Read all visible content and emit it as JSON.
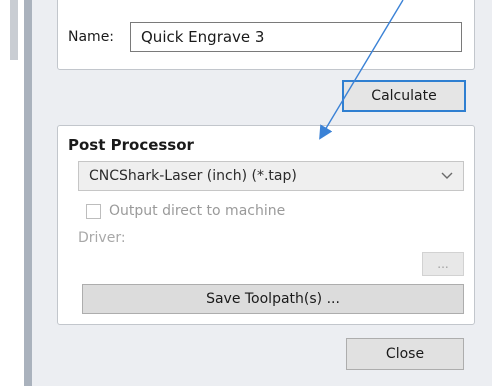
{
  "name_field": {
    "label": "Name:",
    "value": "Quick Engrave 3"
  },
  "calculate_label": "Calculate",
  "post_processor": {
    "title": "Post Processor",
    "selected": "CNCShark-Laser (inch) (*.tap)",
    "output_direct_label": "Output direct to machine",
    "output_direct_checked": false,
    "driver_label": "Driver:",
    "browse_label": "...",
    "save_label": "Save Toolpath(s) ..."
  },
  "close_label": "Close",
  "colors": {
    "accent": "#2f7fd1",
    "panel": "#eceef2",
    "annotation_arrow": "#3b82d6"
  },
  "icons": [
    "chevron-down-icon",
    "arrow-annotation"
  ]
}
